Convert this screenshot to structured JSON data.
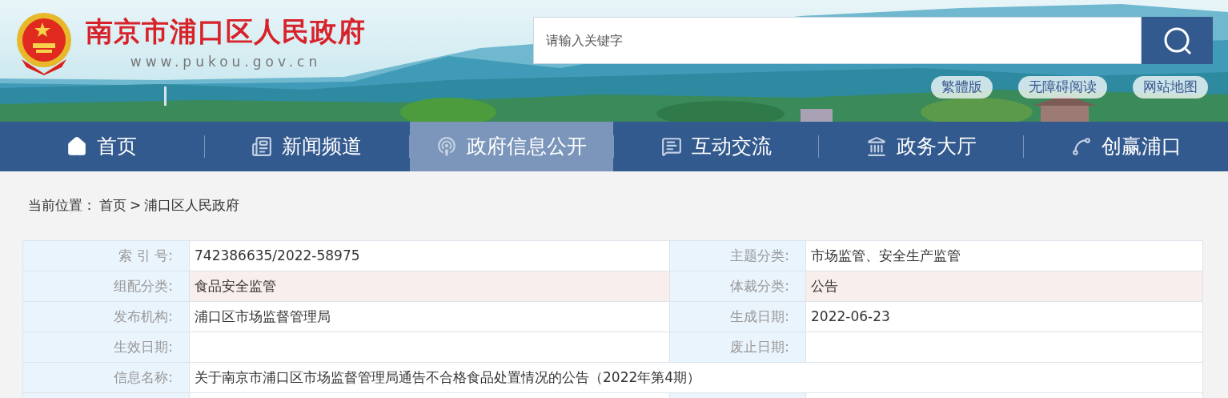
{
  "header": {
    "title": "南京市浦口区人民政府",
    "url": "www.pukou.gov.cn",
    "search": {
      "placeholder": "请输入关键字"
    },
    "links": [
      "繁體版",
      "无障碍阅读",
      "网站地图"
    ]
  },
  "nav": [
    {
      "label": "首页",
      "kind": "home",
      "selected": false
    },
    {
      "label": "新闻频道",
      "kind": "news",
      "selected": false
    },
    {
      "label": "政府信息公开",
      "kind": "broadcast",
      "selected": true
    },
    {
      "label": "互动交流",
      "kind": "chat",
      "selected": false
    },
    {
      "label": "政务大厅",
      "kind": "building",
      "selected": false
    },
    {
      "label": "创赢浦口",
      "kind": "trend",
      "selected": false
    }
  ],
  "breadcrumb": {
    "prefix": "当前位置：",
    "items": [
      "首页",
      "浦口区人民政府"
    ],
    "separator": ">"
  },
  "table": {
    "rows": [
      {
        "kind": "pair",
        "tinted": false,
        "cells": [
          {
            "label": "索 引 号:",
            "value": "742386635/2022-58975"
          },
          {
            "label": "主题分类:",
            "value": "市场监管、安全生产监管"
          }
        ]
      },
      {
        "kind": "pair",
        "tinted": true,
        "cells": [
          {
            "label": "组配分类:",
            "value": "食品安全监管"
          },
          {
            "label": "体裁分类:",
            "value": "公告"
          }
        ]
      },
      {
        "kind": "pair",
        "tinted": false,
        "cells": [
          {
            "label": "发布机构:",
            "value": "浦口区市场监督管理局"
          },
          {
            "label": "生成日期:",
            "value": "2022-06-23"
          }
        ]
      },
      {
        "kind": "pair",
        "tinted": false,
        "cells": [
          {
            "label": "生效日期:"
          },
          {
            "label": "废止日期:"
          }
        ]
      },
      {
        "kind": "wide",
        "tinted": false,
        "cells": [
          {
            "label": "信息名称:",
            "value": "关于南京市浦口区市场监督管理局通告不合格食品处置情况的公告（2022年第4期）"
          }
        ]
      },
      {
        "kind": "pair",
        "tinted": false,
        "cells": [
          {},
          {}
        ]
      }
    ]
  }
}
